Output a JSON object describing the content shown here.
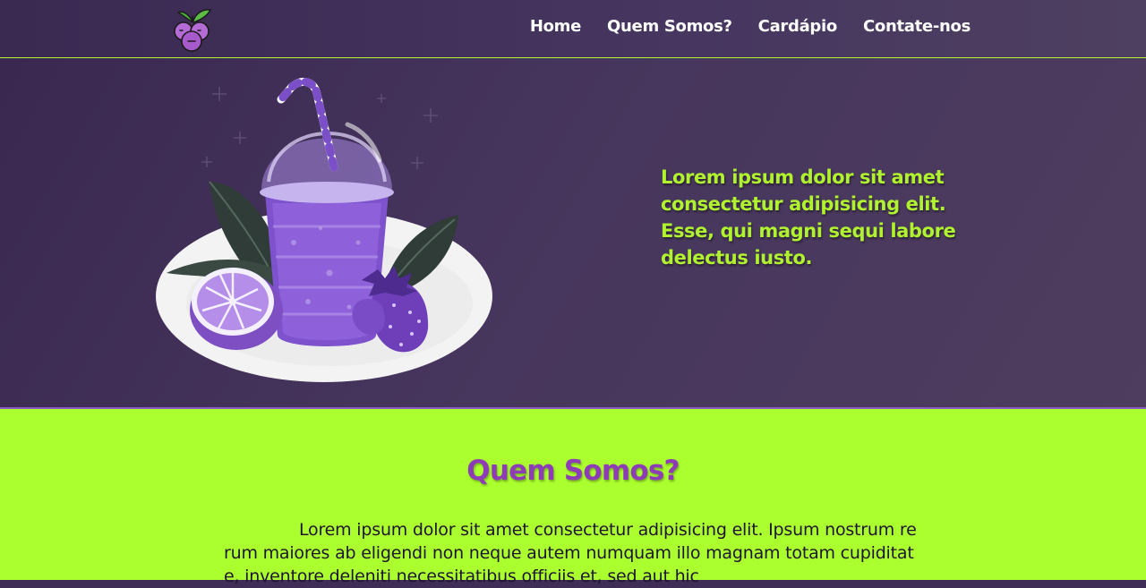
{
  "navbar": {
    "logo_icon": "blueberry-logo-icon",
    "links": [
      "Home",
      "Quem Somos?",
      "Cardápio",
      "Contate-nos"
    ]
  },
  "hero": {
    "illustration_icon": "smoothie-cup-illustration",
    "text": "Lorem ipsum dolor sit amet consectetur adipisicing elit. Esse, qui magni sequi labore delectus iusto."
  },
  "about": {
    "title": "Quem Somos?",
    "text": "Lorem ipsum dolor sit amet consectetur adipisicing elit. Ipsum nostrum rerum maiores ab eligendi non neque autem numquam illo magnam totam cupiditate, inventore deleniti necessitatibus officiis et, sed aut hic"
  },
  "colors": {
    "nav_bg": "#3f2d58",
    "accent_green": "#abff2e",
    "hero_text": "#b0f22f",
    "title_purple": "#8e3bb8"
  }
}
